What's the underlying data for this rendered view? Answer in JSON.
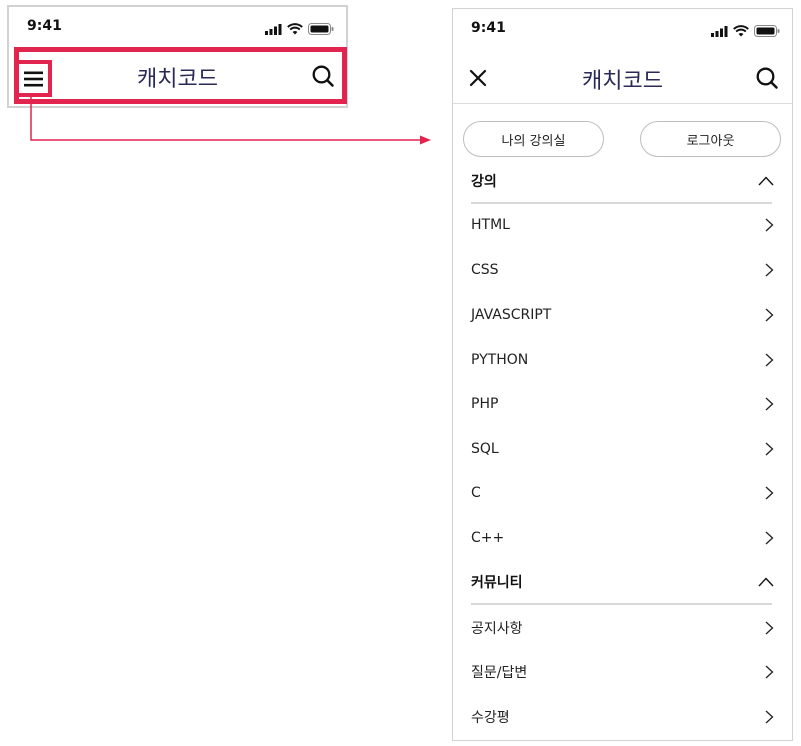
{
  "status": {
    "time": "9:41"
  },
  "app": {
    "title": "캐치코드"
  },
  "drawer": {
    "buttons": {
      "my_classroom": "나의 강의실",
      "logout": "로그아웃"
    },
    "sections": [
      {
        "title": "강의",
        "items": [
          "HTML",
          "CSS",
          "JAVASCRIPT",
          "PYTHON",
          "PHP",
          "SQL",
          "C",
          "C++"
        ]
      },
      {
        "title": "커뮤니티",
        "items": [
          "공지사항",
          "질문/답변",
          "수강평"
        ]
      }
    ]
  },
  "colors": {
    "highlight": "#e2254f",
    "title": "#2a2a55"
  },
  "icons": [
    "menu-icon",
    "search-icon",
    "close-icon",
    "chevron-right-icon",
    "chevron-up-icon",
    "signal-icon",
    "wifi-icon",
    "battery-icon"
  ]
}
